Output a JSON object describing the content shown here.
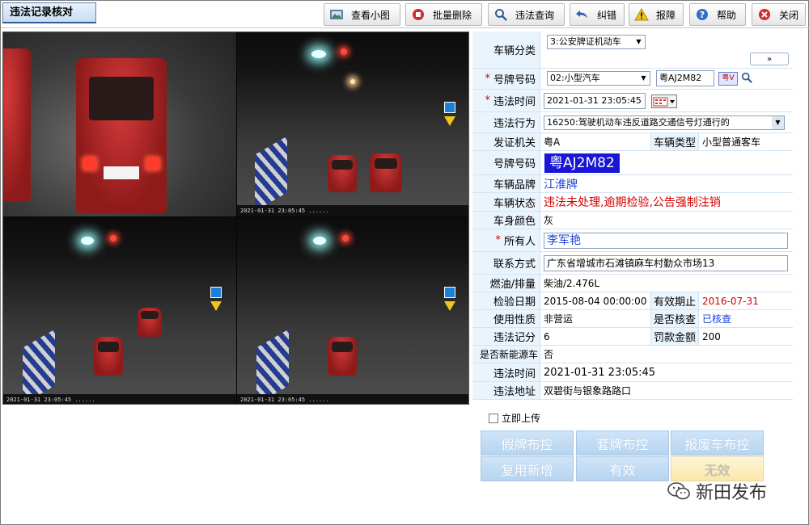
{
  "window": {
    "title": "违法记录核对"
  },
  "toolbar": {
    "items": [
      {
        "label": "查看小图",
        "icon": "picture-icon"
      },
      {
        "label": "批量删除",
        "icon": "delete-icon"
      },
      {
        "label": "违法查询",
        "icon": "search-icon"
      },
      {
        "label": "纠错",
        "icon": "undo-icon"
      },
      {
        "label": "报障",
        "icon": "warning-icon"
      },
      {
        "label": "帮助",
        "icon": "help-icon"
      },
      {
        "label": "关闭",
        "icon": "close-icon"
      }
    ]
  },
  "form": {
    "vehicle_category": {
      "label": "车辆分类",
      "value": "3:公安牌证机动车"
    },
    "expand_icon": "double-chevron-down-icon",
    "plate_type": {
      "label": "号牌号码",
      "select": "02:小型汽车",
      "input": "粤AJ2M82"
    },
    "violation_time_edit": {
      "label": "违法时间",
      "value": "2021-01-31 23:05:45"
    },
    "violation_act": {
      "label": "违法行为",
      "value": "16250:驾驶机动车违反道路交通信号灯通行的"
    },
    "issuing_authority": {
      "label": "发证机关",
      "value": "粤A"
    },
    "vehicle_type": {
      "label": "车辆类型",
      "value": "小型普通客车"
    },
    "plate_number": {
      "label": "号牌号码",
      "value": "粤AJ2M82"
    },
    "brand": {
      "label": "车辆品牌",
      "value": "江淮牌"
    },
    "status": {
      "label": "车辆状态",
      "value": "违法未处理,逾期检验,公告强制注销"
    },
    "color": {
      "label": "车身颜色",
      "value": "灰"
    },
    "owner": {
      "label": "所有人",
      "value": "李军艳"
    },
    "contact": {
      "label": "联系方式",
      "value": "广东省增城市石滩镇麻车村勤众市场13"
    },
    "fuel": {
      "label": "燃油/排量",
      "value": "柴油/2.476L"
    },
    "inspection_date": {
      "label": "检验日期",
      "value": "2015-08-04 00:00:00"
    },
    "valid_until": {
      "label": "有效期止",
      "value": "2016-07-31"
    },
    "usage": {
      "label": "使用性质",
      "value": "非营运"
    },
    "checked": {
      "label": "是否核查",
      "value": "已核查"
    },
    "points": {
      "label": "违法记分",
      "value": "6"
    },
    "fine": {
      "label": "罚款金额",
      "value": "200"
    },
    "new_energy": {
      "label": "是否新能源车",
      "value": "否"
    },
    "violation_time": {
      "label": "违法时间",
      "value": "2021-01-31 23:05:45"
    },
    "location": {
      "label": "违法地址",
      "value": "双碧街与银象路路口"
    }
  },
  "upload": {
    "label": "立即上传"
  },
  "actions": {
    "fake_plate": "假牌布控",
    "cloned_plate": "套牌布控",
    "scrapped": "报废车布控",
    "reuse_new": "复用新增",
    "valid": "有效",
    "invalid": "无效"
  },
  "watermark": {
    "text": "新田发布"
  },
  "colors": {
    "required": "#d40000",
    "link_blue": "#1a3fd8",
    "label_bg": "#eaf4fc",
    "button_blue": "#b6d4f0"
  }
}
